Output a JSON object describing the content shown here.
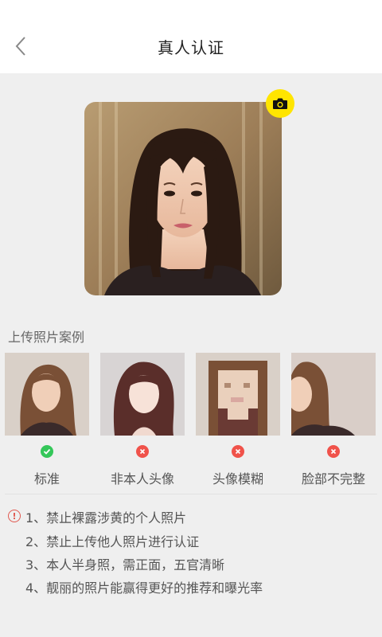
{
  "header": {
    "title": "真人认证",
    "back_icon": "chevron-left-icon"
  },
  "avatar": {
    "camera_icon": "camera-icon",
    "accent_color": "#ffe500"
  },
  "examples_section": {
    "title": "上传照片案例",
    "items": [
      {
        "label": "标准",
        "status": "ok"
      },
      {
        "label": "非本人头像",
        "status": "bad"
      },
      {
        "label": "头像模糊",
        "status": "bad"
      },
      {
        "label": "脸部不完整",
        "status": "bad"
      }
    ]
  },
  "rules": [
    "1、禁止裸露涉黄的个人照片",
    "2、禁止上传他人照片进行认证",
    "3、本人半身照，需正面，五官清晰",
    "4、靓丽的照片能赢得更好的推荐和曝光率"
  ],
  "colors": {
    "ok": "#34c759",
    "bad": "#f0524a",
    "warning": "#e0584f"
  }
}
